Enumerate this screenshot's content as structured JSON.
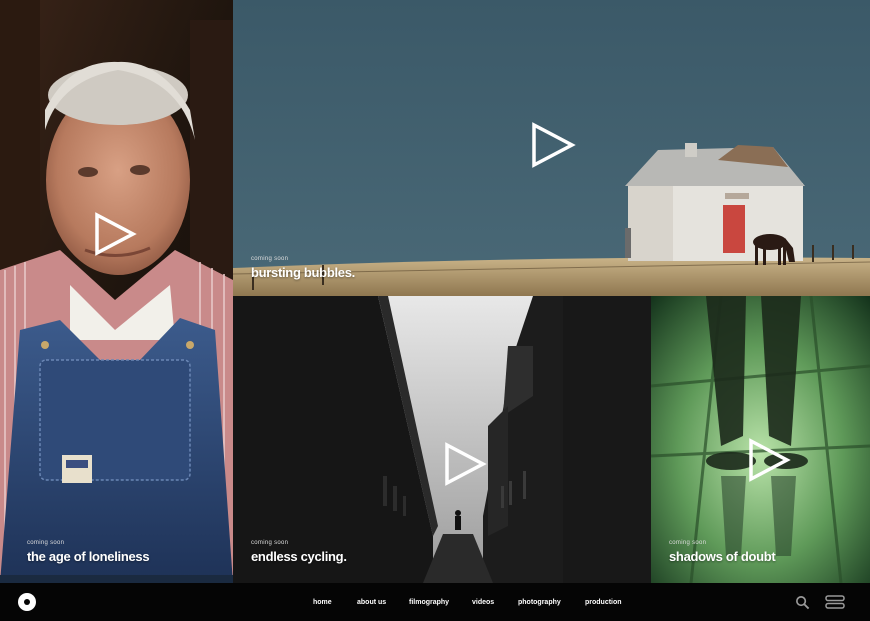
{
  "tiles": [
    {
      "id": "old",
      "sub": "coming soon",
      "title": "the age of loneliness"
    },
    {
      "id": "house",
      "sub": "coming soon",
      "title": "bursting bubbles."
    },
    {
      "id": "alley",
      "sub": "coming soon",
      "title": "endless cycling."
    },
    {
      "id": "green",
      "sub": "coming soon",
      "title": "shadows of doubt"
    }
  ],
  "nav": {
    "items": [
      "home",
      "about us",
      "filmography",
      "videos",
      "photography",
      "production"
    ]
  },
  "icons": {
    "logo": "disc-logo-icon",
    "play": "play-icon",
    "search": "search-icon",
    "menu": "menu-icon"
  },
  "colors": {
    "navbar_bg": "#050505",
    "text": "#ffffff",
    "sky": "#3c5a68",
    "field": "#b49a6c",
    "green_glow": "#7fbf7a"
  }
}
